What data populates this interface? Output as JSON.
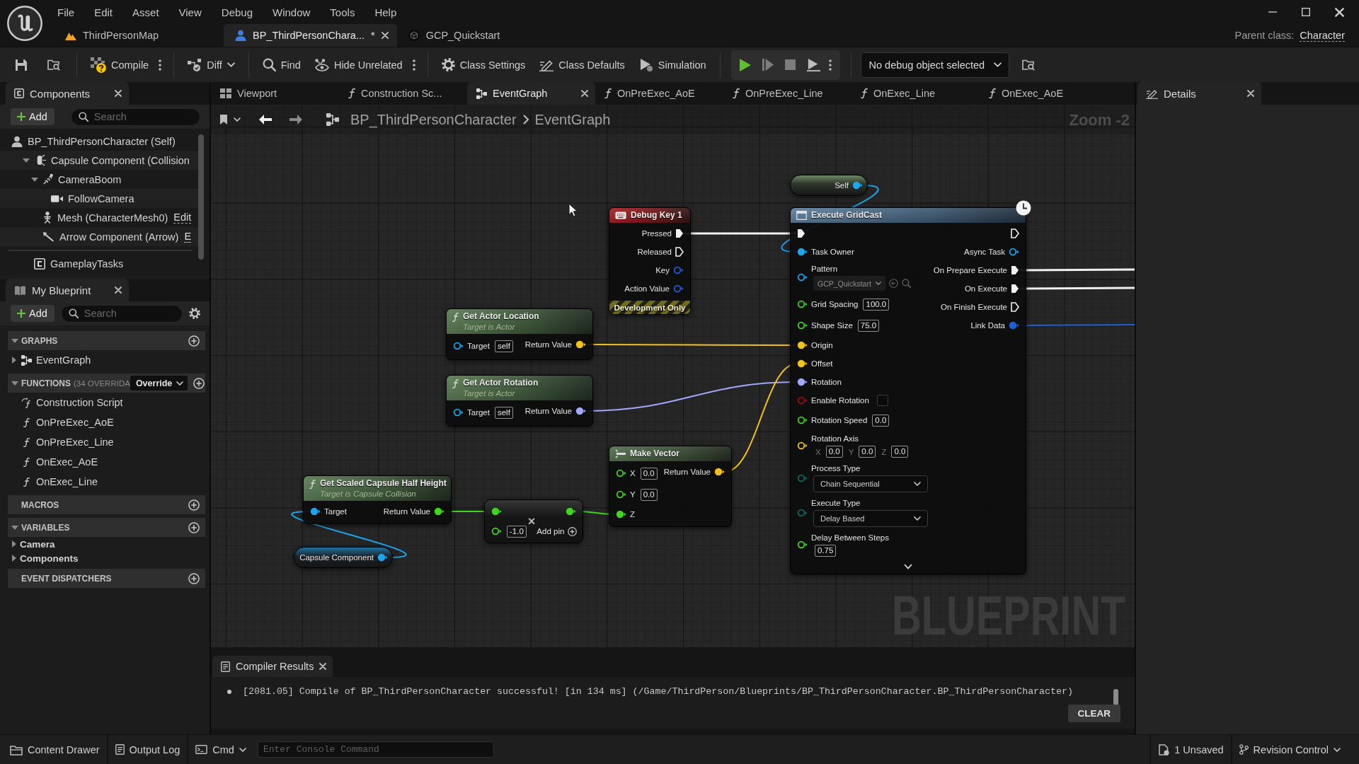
{
  "menu_bar": {
    "items": [
      "File",
      "Edit",
      "Asset",
      "View",
      "Debug",
      "Window",
      "Tools",
      "Help"
    ]
  },
  "document_tabs": [
    {
      "label": "ThirdPersonMap",
      "kind": "map",
      "selected": false
    },
    {
      "label": "BP_ThirdPersonChara...",
      "kind": "blueprint",
      "selected": true,
      "modified_marker": "*"
    },
    {
      "label": "GCP_Quickstart",
      "kind": "asset",
      "selected": false
    }
  ],
  "parent_class": {
    "label": "Parent class:",
    "value": "Character"
  },
  "toolbar": {
    "groups": [
      {
        "kind": "plain",
        "items": [
          {
            "kind": "icon"
          },
          {
            "kind": "icon"
          }
        ]
      },
      {
        "kind": "plain",
        "items": [
          {
            "kind": "button",
            "label": "Compile"
          },
          {
            "kind": "more"
          }
        ]
      },
      {
        "kind": "plain",
        "items": [
          {
            "kind": "dropdown",
            "label": "Diff"
          }
        ]
      },
      {
        "kind": "plain",
        "items": [
          {
            "kind": "button",
            "label": "Find"
          },
          {
            "kind": "button",
            "label": "Hide Unrelated"
          },
          {
            "kind": "more"
          }
        ]
      },
      {
        "kind": "plain",
        "items": [
          {
            "kind": "button",
            "label": "Class Settings"
          },
          {
            "kind": "button",
            "label": "Class Defaults"
          },
          {
            "kind": "button",
            "label": "Simulation"
          }
        ]
      },
      {
        "kind": "boxed",
        "items": [
          {
            "kind": "icon"
          },
          {
            "kind": "icon"
          },
          {
            "kind": "icon"
          },
          {
            "kind": "icon"
          },
          {
            "kind": "more"
          }
        ]
      },
      {
        "kind": "plain",
        "items": [
          {
            "kind": "select",
            "value": "No debug object selected"
          },
          {
            "kind": "icon"
          }
        ]
      }
    ]
  },
  "components_panel": {
    "tab": "Components",
    "add_button": "Add",
    "search": {
      "placeholder": "Search"
    },
    "tree": [
      {
        "label": "BP_ThirdPersonCharacter (Self)",
        "kind": "self",
        "children": [
          {
            "label": "Capsule Component (Collision",
            "kind": "capsule",
            "expanded": true,
            "children": [
              {
                "label": "CameraBoom",
                "kind": "spring_arm",
                "expanded": true,
                "children": [
                  {
                    "label": "FollowCamera",
                    "kind": "camera"
                  }
                ]
              },
              {
                "label": "Mesh (CharacterMesh0)",
                "kind": "mesh",
                "link": "Edit"
              },
              {
                "label": "Arrow Component (Arrow)",
                "kind": "arrow",
                "link": "E"
              }
            ]
          }
        ]
      }
    ],
    "other_components": [
      {
        "label": "GameplayTasks",
        "kind": "component"
      }
    ]
  },
  "my_blueprint": {
    "tab": "My Blueprint",
    "add_button": "Add",
    "search": {
      "placeholder": "Search"
    },
    "sections": [
      {
        "title": "GRAPHS",
        "expanded": true,
        "items": [
          {
            "label": "EventGraph",
            "kind": "graph",
            "expanded": false
          }
        ]
      },
      {
        "title": "FUNCTIONS",
        "note": "(34 OVERRIDA",
        "dropdown": "Override",
        "expanded": true,
        "items": [
          {
            "label": "Construction Script",
            "kind": "construction"
          },
          {
            "label": "OnPreExec_AoE",
            "kind": "function"
          },
          {
            "label": "OnPreExec_Line",
            "kind": "function"
          },
          {
            "label": "OnExec_AoE",
            "kind": "function"
          },
          {
            "label": "OnExec_Line",
            "kind": "function"
          }
        ]
      },
      {
        "title": "MACROS"
      },
      {
        "title": "VARIABLES",
        "expanded": true,
        "items": [
          {
            "label": "Camera",
            "kind": "category",
            "expanded": false
          },
          {
            "label": "Components",
            "kind": "category",
            "expanded": false
          }
        ]
      },
      {
        "title": "EVENT DISPATCHERS"
      }
    ]
  },
  "editor_tabs": [
    {
      "label": "Viewport",
      "kind": "viewport",
      "selected": false
    },
    {
      "label": "Construction Sc...",
      "kind": "function",
      "selected": false
    },
    {
      "label": "EventGraph",
      "kind": "graph",
      "selected": true
    },
    {
      "label": "OnPreExec_AoE",
      "kind": "function",
      "selected": false
    },
    {
      "label": "OnPreExec_Line",
      "kind": "function",
      "selected": false
    },
    {
      "label": "OnExec_Line",
      "kind": "function",
      "selected": false
    },
    {
      "label": "OnExec_AoE",
      "kind": "function",
      "selected": false
    }
  ],
  "graph": {
    "breadcrumb": [
      "BP_ThirdPersonCharacter",
      "EventGraph"
    ],
    "zoom_label": "Zoom -2",
    "graph_label": "BLUEPRINT",
    "nodes": [
      {
        "kind": "self",
        "outputs": [
          {
            "label": "Self",
            "kind": "data",
            "color": "#1ba6f0",
            "connected": true
          }
        ]
      },
      {
        "kind": "event",
        "title": "Debug Key 1",
        "footer": "Development Only",
        "outputs": [
          {
            "label": "Pressed",
            "kind": "exec",
            "connected": true
          },
          {
            "label": "Released",
            "kind": "exec",
            "connected": false
          },
          {
            "label": "Key",
            "kind": "data",
            "color": "#1d5fd6",
            "connected": false
          },
          {
            "label": "Action Value",
            "kind": "data",
            "color": "#1d5fd6",
            "connected": false
          }
        ]
      },
      {
        "kind": "async",
        "title": "Execute GridCast",
        "latent": true,
        "inputs": [
          {
            "kind": "exec",
            "connected": true
          },
          {
            "label": "Task Owner",
            "kind": "data",
            "color": "#1ba6f0",
            "connected": true
          },
          {
            "label": "Pattern",
            "kind": "data",
            "color": "#1ba6f0",
            "connected": false,
            "widget": {
              "kind": "asset",
              "value": "GCP_Quickstart"
            }
          },
          {
            "label": "Grid Spacing",
            "kind": "data",
            "color": "#3fd61f",
            "connected": false,
            "widget": {
              "kind": "number",
              "value": "100.0"
            }
          },
          {
            "label": "Shape Size",
            "kind": "data",
            "color": "#3fd61f",
            "connected": false,
            "widget": {
              "kind": "number",
              "value": "75.0"
            }
          },
          {
            "label": "Origin",
            "kind": "data",
            "color": "#f5c21a",
            "connected": true
          },
          {
            "label": "Offset",
            "kind": "data",
            "color": "#f5c21a",
            "connected": true
          },
          {
            "label": "Rotation",
            "kind": "data",
            "color": "#a3a8ff",
            "connected": true
          },
          {
            "label": "Enable Rotation",
            "kind": "data",
            "color": "#9b0c0c",
            "connected": false,
            "widget": {
              "kind": "checkbox",
              "checked": false
            }
          },
          {
            "label": "Rotation Speed",
            "kind": "data",
            "color": "#3fd61f",
            "connected": false,
            "widget": {
              "kind": "number",
              "value": "0.0"
            }
          },
          {
            "label": "Rotation Axis",
            "kind": "data",
            "color": "#f5c21a",
            "connected": false,
            "widget": {
              "kind": "vector",
              "values": [
                {
                  "axis": "X",
                  "value": "0.0"
                },
                {
                  "axis": "Y",
                  "value": "0.0"
                },
                {
                  "axis": "Z",
                  "value": "0.0"
                }
              ]
            }
          },
          {
            "label": "Process Type",
            "kind": "data",
            "color": "#0b6b63",
            "connected": false,
            "widget": {
              "kind": "enum",
              "value": "Chain Sequential"
            }
          },
          {
            "label": "Execute Type",
            "kind": "data",
            "color": "#0b6b63",
            "connected": false,
            "widget": {
              "kind": "enum",
              "value": "Delay Based"
            }
          },
          {
            "label": "Delay Between Steps",
            "kind": "data",
            "color": "#3fd61f",
            "connected": false,
            "widget": {
              "kind": "number",
              "value": "0.75"
            }
          }
        ],
        "outputs": [
          {
            "kind": "exec",
            "connected": false
          },
          {
            "label": "Async Task",
            "kind": "data",
            "color": "#1ba6f0",
            "connected": false
          },
          {
            "label": "On Prepare Execute",
            "kind": "exec",
            "connected": true
          },
          {
            "label": "On Execute",
            "kind": "exec",
            "connected": true
          },
          {
            "label": "On Finish Execute",
            "kind": "exec",
            "connected": false
          },
          {
            "label": "Link Data",
            "kind": "data",
            "color": "#1d5fd6",
            "connected": true
          }
        ]
      },
      {
        "kind": "function",
        "title": "Get Actor Location",
        "subtitle": "Target is Actor",
        "inputs": [
          {
            "label": "Target",
            "kind": "data",
            "color": "#1ba6f0",
            "connected": false,
            "widget": {
              "kind": "text",
              "value": "self"
            }
          }
        ],
        "outputs": [
          {
            "label": "Return Value",
            "kind": "data",
            "color": "#f5c21a",
            "connected": true
          }
        ]
      },
      {
        "kind": "function",
        "title": "Get Actor Rotation",
        "subtitle": "Target is Actor",
        "inputs": [
          {
            "label": "Target",
            "kind": "data",
            "color": "#1ba6f0",
            "connected": false,
            "widget": {
              "kind": "text",
              "value": "self"
            }
          }
        ],
        "outputs": [
          {
            "label": "Return Value",
            "kind": "data",
            "color": "#a3a8ff",
            "connected": true
          }
        ]
      },
      {
        "kind": "function",
        "title": "Get Scaled Capsule Half Height",
        "subtitle": "Target is Capsule Collision",
        "inputs": [
          {
            "label": "Target",
            "kind": "data",
            "color": "#1ba6f0",
            "connected": true
          }
        ],
        "outputs": [
          {
            "label": "Return Value",
            "kind": "data",
            "color": "#3fd61f",
            "connected": true
          }
        ]
      },
      {
        "kind": "math",
        "operator": "×",
        "add_pin": "Add pin",
        "inputs": [
          {
            "kind": "data",
            "color": "#3fd61f",
            "connected": true
          },
          {
            "kind": "data",
            "color": "#3fd61f",
            "connected": false,
            "widget": {
              "kind": "number",
              "value": "-1.0"
            }
          }
        ],
        "outputs": [
          {
            "kind": "data",
            "color": "#3fd61f",
            "connected": true
          }
        ]
      },
      {
        "kind": "make",
        "title": "Make Vector",
        "inputs": [
          {
            "label": "X",
            "kind": "data",
            "color": "#3fd61f",
            "connected": false,
            "widget": {
              "kind": "number",
              "value": "0.0"
            }
          },
          {
            "label": "Y",
            "kind": "data",
            "color": "#3fd61f",
            "connected": false,
            "widget": {
              "kind": "number",
              "value": "0.0"
            }
          },
          {
            "label": "Z",
            "kind": "data",
            "color": "#3fd61f",
            "connected": true
          }
        ],
        "outputs": [
          {
            "label": "Return Value",
            "kind": "data",
            "color": "#f5c21a",
            "connected": true
          }
        ]
      },
      {
        "kind": "variable",
        "outputs": [
          {
            "label": "Capsule Component",
            "kind": "data",
            "color": "#1ba6f0",
            "connected": true
          }
        ]
      }
    ]
  },
  "details_panel": {
    "tab": "Details"
  },
  "compiler_results": {
    "tab": "Compiler Results",
    "messages": [
      "[2081.05] Compile of BP_ThirdPersonCharacter successful! [in 134 ms] (/Game/ThirdPerson/Blueprints/BP_ThirdPersonCharacter.BP_ThirdPersonCharacter)"
    ],
    "clear_button": "CLEAR"
  },
  "status_bar": {
    "left": [
      {
        "label": "Content Drawer",
        "kind": "button"
      },
      {
        "label": "Output Log",
        "kind": "button"
      },
      {
        "label": "Cmd",
        "kind": "dropdown"
      }
    ],
    "console": {
      "placeholder": "Enter Console Command"
    },
    "right": [
      {
        "label": "1 Unsaved",
        "kind": "button"
      },
      {
        "label": "Revision Control",
        "kind": "dropdown"
      }
    ]
  }
}
